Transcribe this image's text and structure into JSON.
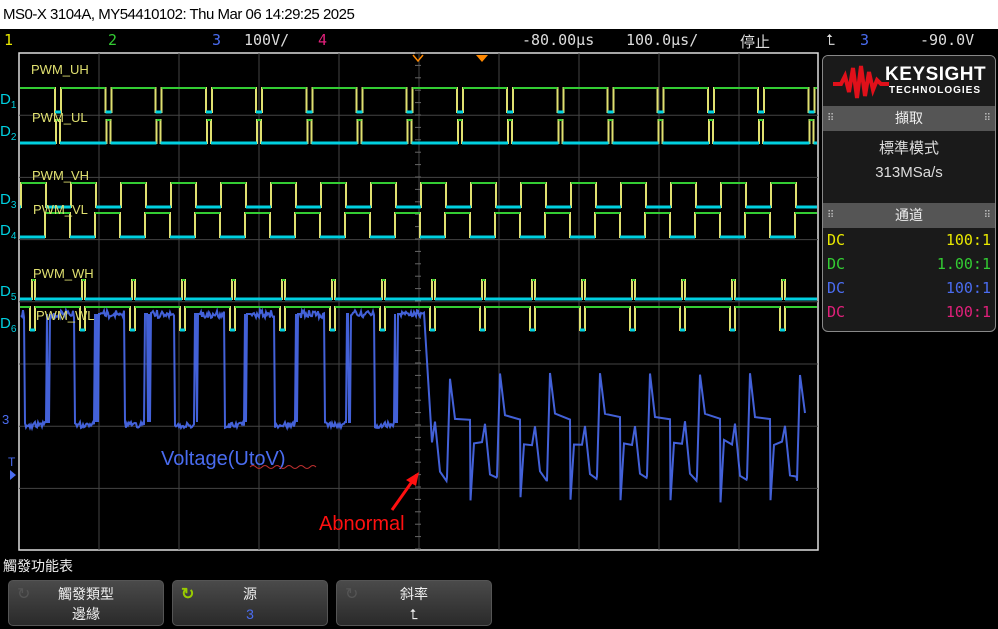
{
  "title": "MS0-X 3104A, MY54410102: Thu Mar 06 14:29:25 2025",
  "status": {
    "ch1": "1",
    "ch2": "2",
    "ch3": "3",
    "ch3_scale": "100V/",
    "ch4": "4",
    "delay": "-80.00µs",
    "timebase": "100.0µs/",
    "run_state": "停止",
    "trigger_slope": "⮤",
    "trigger_source": "3",
    "trigger_level": "-90.0V"
  },
  "colors": {
    "ch1": "#e8e800",
    "ch2": "#33cc33",
    "ch3": "#4a6cf0",
    "ch4": "#e0207a",
    "digital_high": "#33cc33",
    "digital_low": "#00d0e0",
    "digital_edge": "#e0e070",
    "annotation": "#ff1010"
  },
  "digital_labels": [
    "D1",
    "D2",
    "D3",
    "D4",
    "D5",
    "D6"
  ],
  "signal_names": [
    "PWM_UH",
    "PWM_UL",
    "PWM_VH",
    "PWM_VL",
    "PWM_WH",
    "PWM_WL"
  ],
  "annotations": {
    "voltage": "Voltage(UtoV)",
    "abnormal": "Abnormal"
  },
  "markers": {
    "analog_ch": "3",
    "trigger": "T"
  },
  "panel": {
    "brand": "KEYSIGHT",
    "brand_sub": "TECHNOLOGIES",
    "acq_header": "擷取",
    "acq_mode": "標準模式",
    "sample_rate": "313MSa/s",
    "channel_header": "通道",
    "channels": [
      {
        "coupling": "DC",
        "probe": "100:1"
      },
      {
        "coupling": "DC",
        "probe": "1.00:1"
      },
      {
        "coupling": "DC",
        "probe": "100:1"
      },
      {
        "coupling": "DC",
        "probe": "100:1"
      }
    ]
  },
  "menu": {
    "title": "觸發功能表",
    "softkeys": [
      {
        "label": "觸發類型",
        "value": "邊緣"
      },
      {
        "label": "源",
        "value": "3"
      },
      {
        "label": "斜率",
        "value": "⮤"
      }
    ]
  }
}
